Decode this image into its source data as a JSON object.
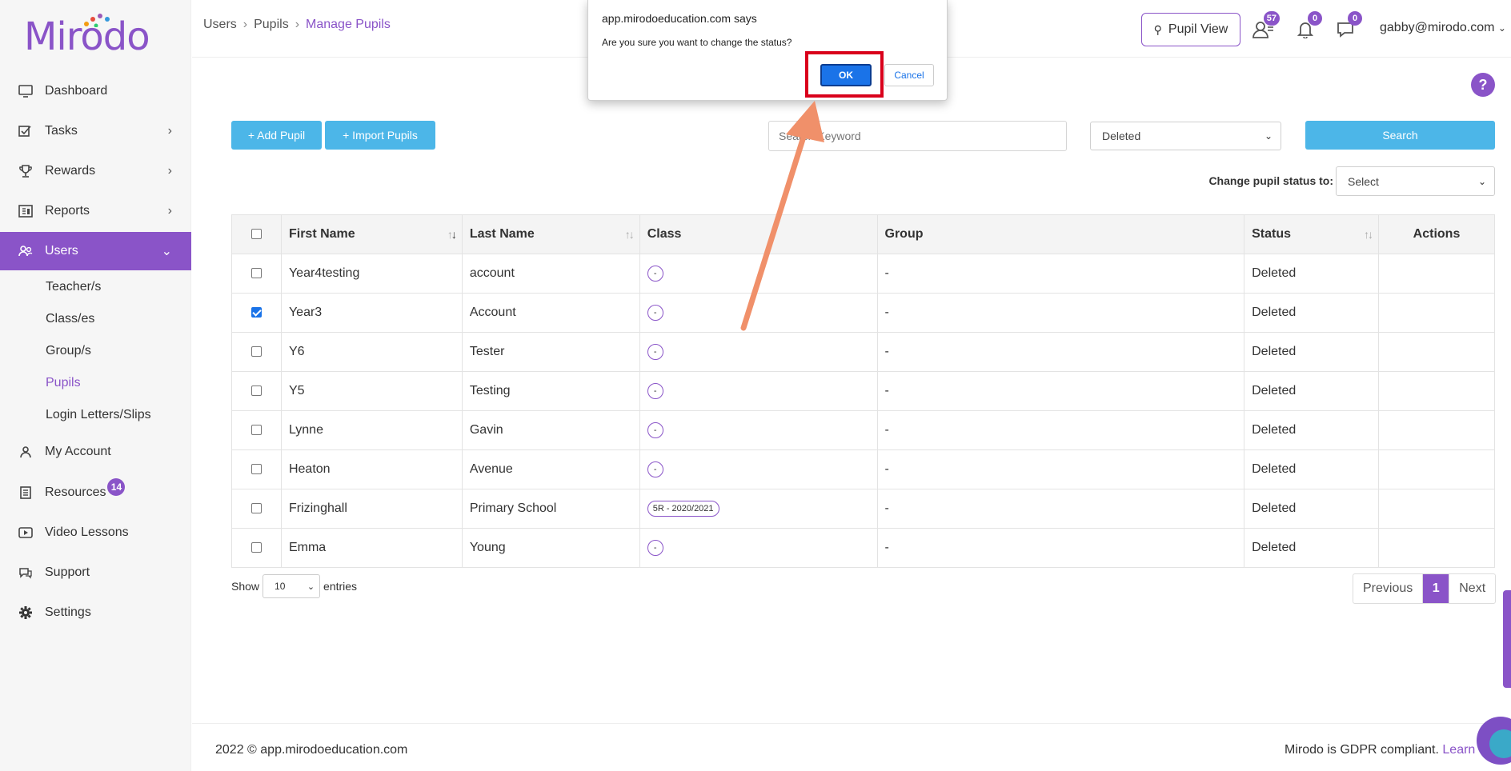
{
  "brand": {
    "logo_text": "Mirodo",
    "accent": "#8a54c8",
    "button_blue": "#4cb6e8"
  },
  "sidebar": {
    "items": [
      {
        "label": "Dashboard",
        "icon": "monitor-icon"
      },
      {
        "label": "Tasks",
        "icon": "tasks-icon",
        "chevron": "›"
      },
      {
        "label": "Rewards",
        "icon": "trophy-icon",
        "chevron": "›"
      },
      {
        "label": "Reports",
        "icon": "report-icon",
        "chevron": "›"
      },
      {
        "label": "Users",
        "icon": "users-icon",
        "chevron": "⌄"
      },
      {
        "label": "My Account",
        "icon": "account-icon"
      },
      {
        "label": "Resources",
        "icon": "resources-icon",
        "badge": "14"
      },
      {
        "label": "Video Lessons",
        "icon": "video-icon"
      },
      {
        "label": "Support",
        "icon": "support-icon"
      },
      {
        "label": "Settings",
        "icon": "gear-icon"
      }
    ],
    "users_sub": [
      "Teacher/s",
      "Class/es",
      "Group/s",
      "Pupils",
      "Login Letters/Slips"
    ]
  },
  "header": {
    "breadcrumb": [
      "Users",
      "Pupils",
      "Manage Pupils"
    ],
    "pupil_view": "Pupil View",
    "badges": {
      "users": "57",
      "bell": "0",
      "chat": "0"
    },
    "user": "gabby@mirodo.com"
  },
  "toolbar": {
    "add_pupil": "+ Add Pupil",
    "import_pupils": "+ Import Pupils",
    "search_placeholder": "Search Keyword",
    "filter_value": "Deleted",
    "search_button": "Search",
    "change_status_label": "Change pupil status to:",
    "change_status_value": "Select",
    "help": "?"
  },
  "table": {
    "headers": [
      "First Name",
      "Last Name",
      "Class",
      "Group",
      "Status",
      "Actions"
    ],
    "rows": [
      {
        "first": "Year4testing",
        "last": "account",
        "class": "-",
        "group": "-",
        "status": "Deleted",
        "checked": false
      },
      {
        "first": "Year3",
        "last": "Account",
        "class": "-",
        "group": "-",
        "status": "Deleted",
        "checked": true
      },
      {
        "first": "Y6",
        "last": "Tester",
        "class": "-",
        "group": "-",
        "status": "Deleted",
        "checked": false
      },
      {
        "first": "Y5",
        "last": "Testing",
        "class": "-",
        "group": "-",
        "status": "Deleted",
        "checked": false
      },
      {
        "first": "Lynne",
        "last": "Gavin",
        "class": "-",
        "group": "-",
        "status": "Deleted",
        "checked": false
      },
      {
        "first": "Heaton",
        "last": "Avenue",
        "class": "-",
        "group": "-",
        "status": "Deleted",
        "checked": false
      },
      {
        "first": "Frizinghall",
        "last": "Primary School",
        "class": "5R - 2020/2021",
        "group": "-",
        "status": "Deleted",
        "checked": false
      },
      {
        "first": "Emma",
        "last": "Young",
        "class": "-",
        "group": "-",
        "status": "Deleted",
        "checked": false
      }
    ]
  },
  "pagination": {
    "show": "Show",
    "entries_value": "10",
    "entries": "entries",
    "previous": "Previous",
    "page": "1",
    "next": "Next"
  },
  "footer": {
    "left": "2022 © app.mirodoeducation.com",
    "right": "Mirodo is GDPR compliant.",
    "link": "Learn"
  },
  "dialog": {
    "title": "app.mirodoeducation.com says",
    "message": "Are you sure you want to change the status?",
    "ok": "OK",
    "cancel": "Cancel",
    "highlight_color": "#d9001b",
    "arrow_color": "#f0906a"
  }
}
